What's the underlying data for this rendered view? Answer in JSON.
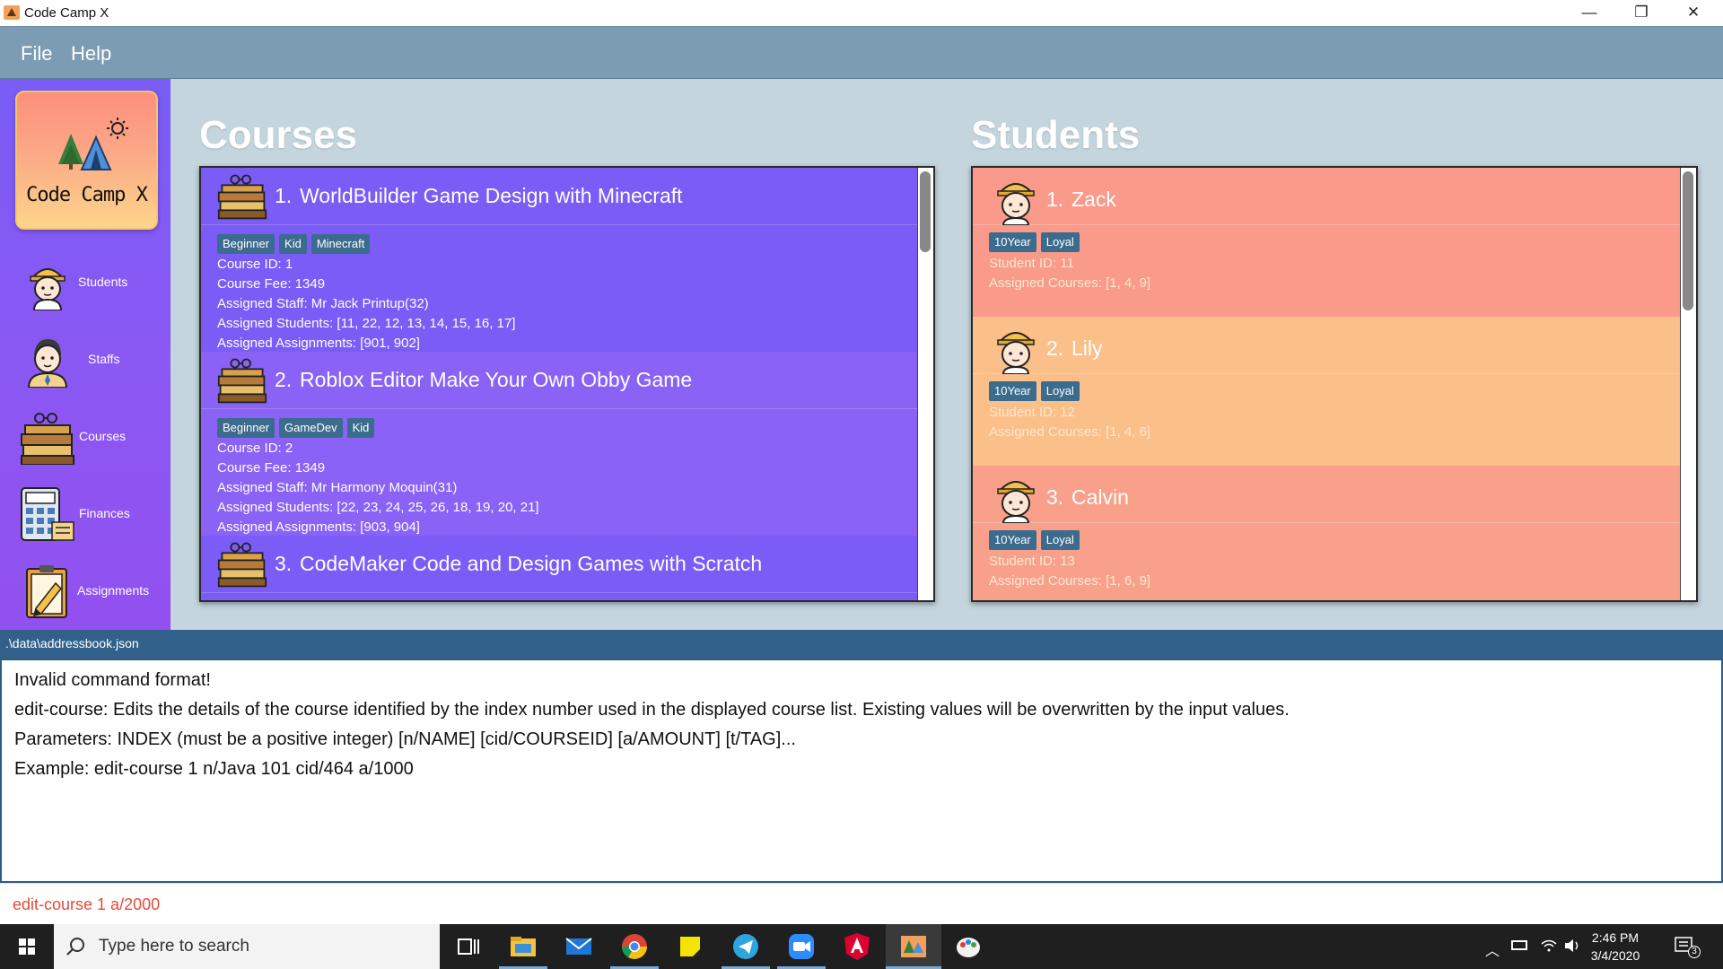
{
  "window": {
    "title": "Code Camp X",
    "controls": {
      "minimize": "—",
      "maximize": "❐",
      "close": "✕"
    }
  },
  "menu": {
    "items": [
      "File",
      "Help"
    ]
  },
  "sidebar": {
    "logo_text": "Code Camp X",
    "items": [
      {
        "label": "Students",
        "icon": "student-icon"
      },
      {
        "label": "Staffs",
        "icon": "staff-icon"
      },
      {
        "label": "Courses",
        "icon": "courses-icon"
      },
      {
        "label": "Finances",
        "icon": "calculator-icon"
      },
      {
        "label": "Assignments",
        "icon": "assignment-icon"
      }
    ]
  },
  "courses": {
    "title": "Courses",
    "items": [
      {
        "index": "1.",
        "name": "WorldBuilder Game Design with Minecraft",
        "tags": [
          "Beginner",
          "Kid",
          "Minecraft"
        ],
        "course_id": "Course ID: 1",
        "fee": "Course Fee: 1349",
        "staff": "Assigned Staff: Mr Jack Printup(32)",
        "students": "Assigned Students: [11, 22, 12, 13, 14, 15, 16, 17]",
        "assignments": "Assigned Assignments: [901, 902]"
      },
      {
        "index": "2.",
        "name": "Roblox Editor Make Your Own Obby Game",
        "tags": [
          "Beginner",
          "GameDev",
          "Kid"
        ],
        "course_id": "Course ID: 2",
        "fee": "Course Fee: 1349",
        "staff": "Assigned Staff: Mr Harmony Moquin(31)",
        "students": "Assigned Students: [22, 23, 24, 25, 26, 18, 19, 20, 21]",
        "assignments": "Assigned Assignments: [903, 904]"
      },
      {
        "index": "3.",
        "name": "CodeMaker Code and Design Games with Scratch"
      }
    ]
  },
  "students": {
    "title": "Students",
    "items": [
      {
        "index": "1.",
        "name": "Zack",
        "tags": [
          "10Year",
          "Loyal"
        ],
        "student_id": "Student ID: 11",
        "courses": "Assigned Courses: [1, 4, 9]"
      },
      {
        "index": "2.",
        "name": "Lily",
        "tags": [
          "10Year",
          "Loyal"
        ],
        "student_id": "Student ID: 12",
        "courses": "Assigned Courses: [1, 4, 6]"
      },
      {
        "index": "3.",
        "name": "Calvin",
        "tags": [
          "10Year",
          "Loyal"
        ],
        "student_id": "Student ID: 13",
        "courses": "Assigned Courses: [1, 6, 9]"
      }
    ]
  },
  "status": {
    "path": ".\\data\\addressbook.json"
  },
  "result": {
    "lines": [
      "Invalid command format!",
      "edit-course: Edits the details of the course identified by the index number used in the displayed course list. Existing values will be overwritten by the input values.",
      "Parameters: INDEX (must be a positive integer) [n/NAME] [cid/COURSEID] [a/AMOUNT] [t/TAG]...",
      "Example: edit-course 1 n/Java 101 cid/464 a/1000"
    ]
  },
  "command": {
    "value": "edit-course 1 a/2000"
  },
  "taskbar": {
    "search_placeholder": "Type here to search",
    "time": "2:46 PM",
    "date": "3/4/2020",
    "notification_count": "3"
  },
  "colors": {
    "menubar": "#7b9cb2",
    "sidebar": "#7a5cf6",
    "content_bg": "#c5d5de",
    "course_panel": "#7b5cf6",
    "student_panel": "#f79b8a",
    "tag": "#3b6b8d",
    "status_bar": "#31618a",
    "command_text": "#e24b3a"
  }
}
